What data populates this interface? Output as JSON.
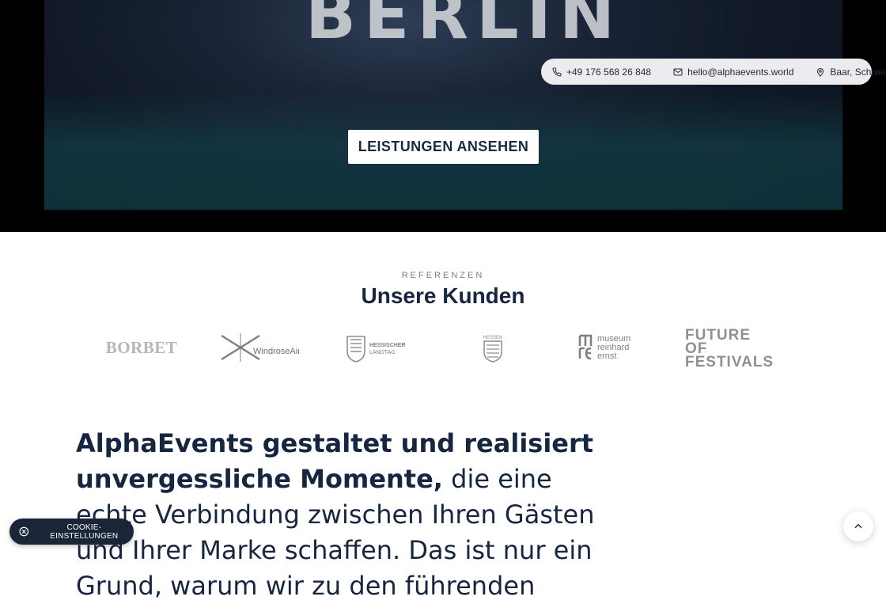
{
  "hero": {
    "sign_text": "BERLIN",
    "cta_label": "LEISTUNGEN ANSEHEN"
  },
  "contact_bar": {
    "phone": "+49 176 568 26 848",
    "email": "hello@alphaevents.world",
    "location": "Baar, Schweiz",
    "icons": [
      "phone-icon",
      "mail-icon",
      "location-pin-icon"
    ]
  },
  "references": {
    "eyebrow": "REFERENZEN",
    "title": "Unsere Kunden",
    "logos": [
      {
        "name": "BORBET",
        "text": "BORBET"
      },
      {
        "name": "WindroseAir",
        "text": "WindroseAir"
      },
      {
        "name": "Hessischer Landtag",
        "line1": "HESSISCHER",
        "line2": "LANDTAG"
      },
      {
        "name": "Hessen",
        "text": "HESSEN"
      },
      {
        "name": "museum reinhard ernst",
        "line1": "museum",
        "line2": "reinhard",
        "line3": "ernst"
      },
      {
        "name": "Future of Festivals",
        "line1": "FUTURE OF",
        "line2": "FESTIVALS"
      }
    ]
  },
  "statement": {
    "bold_part": "AlphaEvents gestaltet und realisiert unvergessliche Momente,",
    "regular_part": " die eine echte Verbindung zwischen Ihren Gästen und Ihrer Marke schaffen. Das ist nur ein Grund, warum wir zu den führenden"
  },
  "cookie": {
    "label": "COOKIE-EINSTELLUNGEN"
  },
  "colors": {
    "navy": "#172640",
    "cookie_bg": "#1a2638",
    "pill_bg": "#ececee",
    "logo_gray": "#8d9195"
  }
}
